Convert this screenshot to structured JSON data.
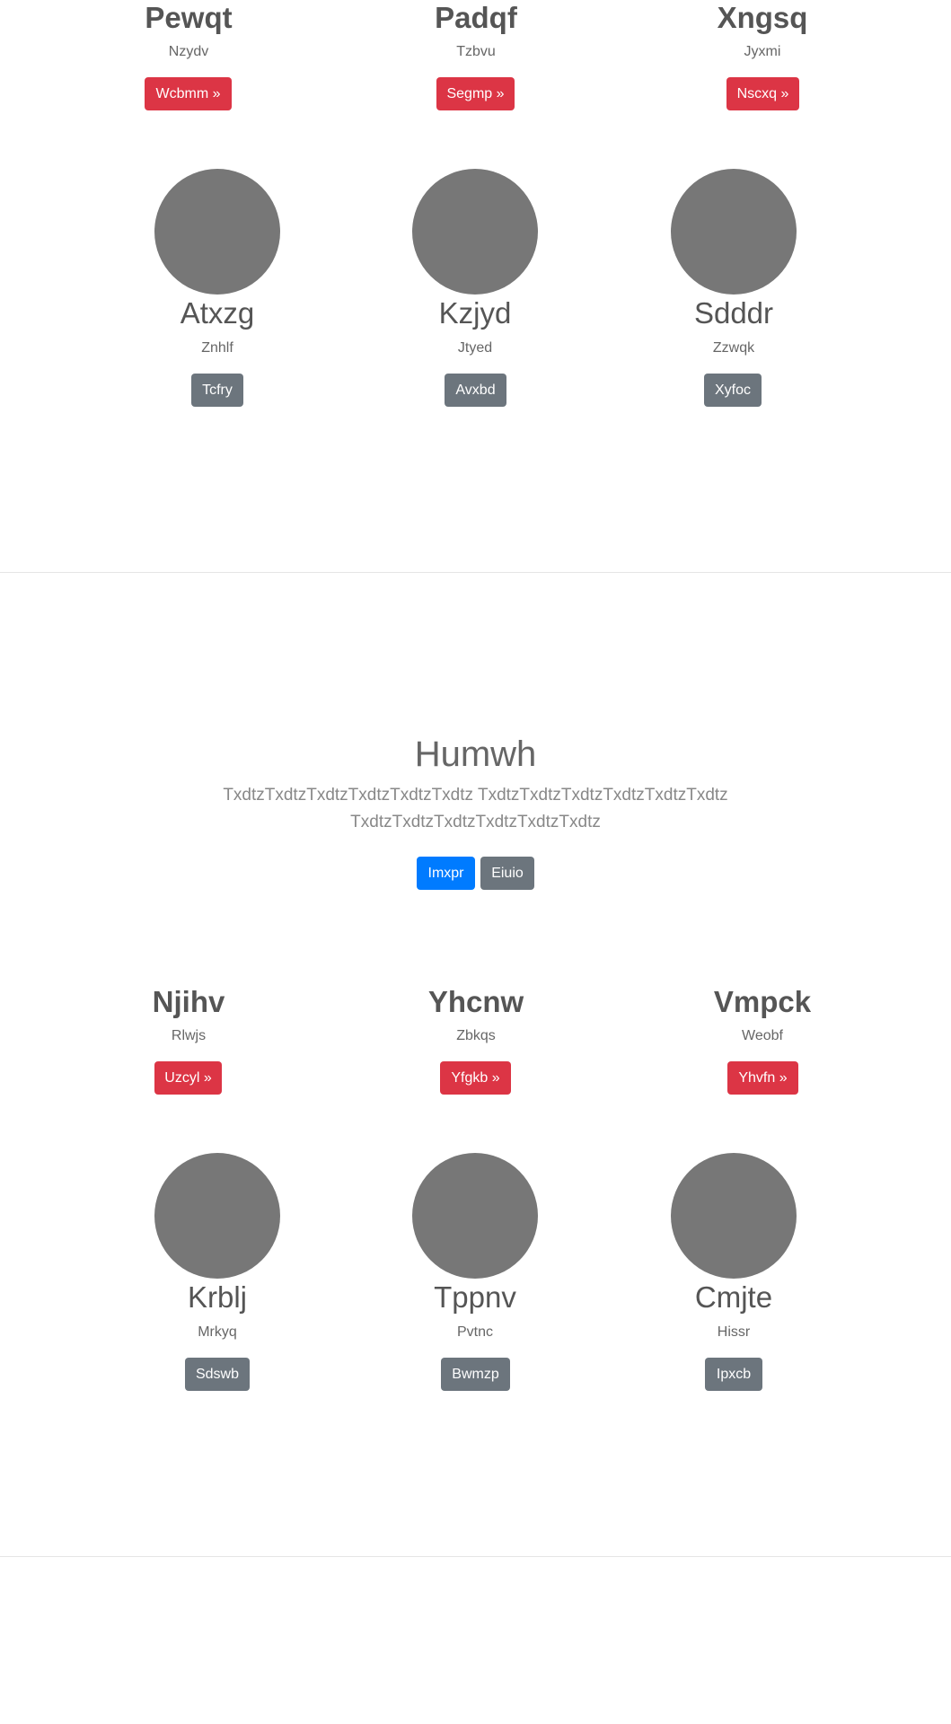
{
  "section1": {
    "features": [
      {
        "title": "Pewqt",
        "subtitle": "Nzydv",
        "button": "Wcbmm »"
      },
      {
        "title": "Padqf",
        "subtitle": "Tzbvu",
        "button": "Segmp »"
      },
      {
        "title": "Xngsq",
        "subtitle": "Jyxmi",
        "button": "Nscxq »"
      }
    ],
    "team": [
      {
        "name": "Atxzg",
        "role": "Znhlf",
        "button": "Tcfry"
      },
      {
        "name": "Kzjyd",
        "role": "Jtyed",
        "button": "Avxbd"
      },
      {
        "name": "Sdddr",
        "role": "Zzwqk",
        "button": "Xyfoc"
      }
    ]
  },
  "hero": {
    "title": "Humwh",
    "text_line1": "TxdtzTxdtzTxdtzTxdtzTxdtzTxdtz TxdtzTxdtzTxdtzTxdtzTxdtzTxdtz",
    "text_line2": "TxdtzTxdtzTxdtzTxdtzTxdtzTxdtz",
    "primary_button": "Imxpr",
    "secondary_button": "Eiuio"
  },
  "section2": {
    "features": [
      {
        "title": "Njihv",
        "subtitle": "Rlwjs",
        "button": "Uzcyl »"
      },
      {
        "title": "Yhcnw",
        "subtitle": "Zbkqs",
        "button": "Yfgkb »"
      },
      {
        "title": "Vmpck",
        "subtitle": "Weobf",
        "button": "Yhvfn »"
      }
    ],
    "team": [
      {
        "name": "Krblj",
        "role": "Mrkyq",
        "button": "Sdswb"
      },
      {
        "name": "Tppnv",
        "role": "Pvtnc",
        "button": "Bwmzp"
      },
      {
        "name": "Cmjte",
        "role": "Hissr",
        "button": "Ipxcb"
      }
    ]
  },
  "colors": {
    "danger": "#dc3545",
    "secondary": "#6c757d",
    "primary": "#007bff",
    "avatar_placeholder": "#777777"
  }
}
